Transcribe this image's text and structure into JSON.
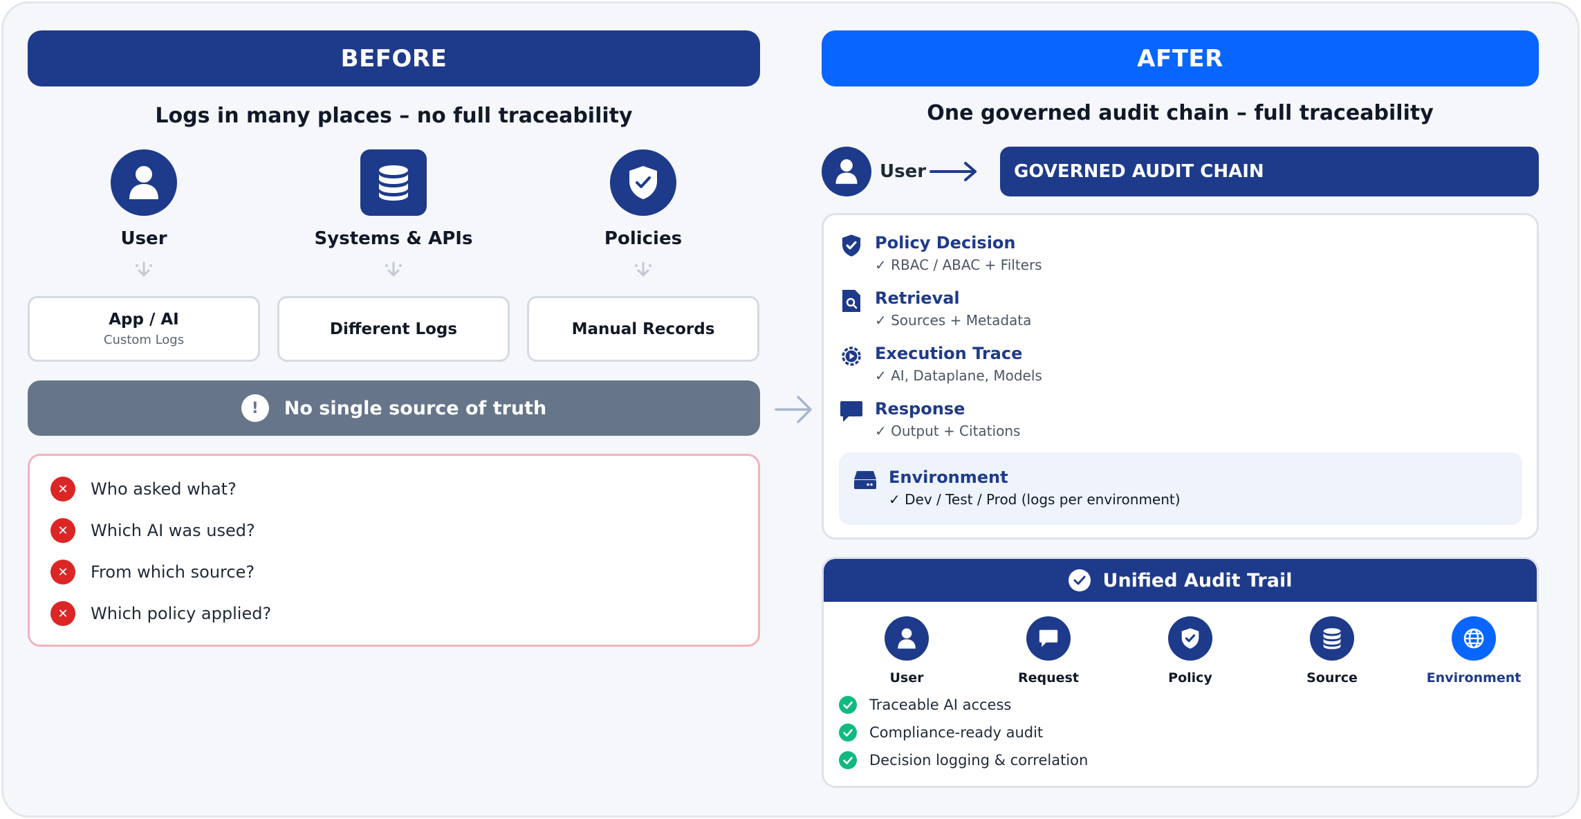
{
  "colors": {
    "navy": "#1e3a8a",
    "bright_blue": "#0866ff",
    "slate": "#667589",
    "error_red": "#dc2626",
    "success_green": "#10b981",
    "error_border": "#f1b3bb",
    "env_panel": "#eef3fc"
  },
  "before": {
    "header": "BEFORE",
    "subtitle": "Logs in many places – no full traceability",
    "columns": [
      {
        "icon": "user-icon",
        "label": "User",
        "box_title": "App / AI",
        "box_sub": "Custom Logs"
      },
      {
        "icon": "database-icon",
        "label": "Systems & APIs",
        "box_title": "Different Logs",
        "box_sub": ""
      },
      {
        "icon": "shield-check-icon",
        "label": "Policies",
        "box_title": "Manual Records",
        "box_sub": ""
      }
    ],
    "no_truth": {
      "icon": "exclamation-icon",
      "glyph": "!",
      "label": "No single source of truth"
    },
    "questions": [
      "Who asked what?",
      "Which AI was used?",
      "From which source?",
      "Which policy applied?"
    ]
  },
  "after": {
    "header": "AFTER",
    "subtitle": "One governed audit chain – full traceability",
    "user_label": "User",
    "chain_label": "GOVERNED AUDIT CHAIN",
    "steps": [
      {
        "icon": "shield-check-icon",
        "title": "Policy Decision",
        "detail": "✓ RBAC / ABAC + Filters"
      },
      {
        "icon": "document-search-icon",
        "title": "Retrieval",
        "detail": "✓ Sources + Metadata"
      },
      {
        "icon": "gear-play-icon",
        "title": "Execution Trace",
        "detail": "✓ AI, Dataplane, Models"
      },
      {
        "icon": "chat-bubble-icon",
        "title": "Response",
        "detail": "✓ Output + Citations"
      }
    ],
    "environment": {
      "icon": "server-icon",
      "title": "Environment",
      "detail": "✓ Dev / Test / Prod (logs per environment)"
    },
    "trail": {
      "title": "Unified Audit Trail",
      "items": [
        {
          "icon": "user-icon",
          "label": "User",
          "highlight": false
        },
        {
          "icon": "chat-bubble-icon",
          "label": "Request",
          "highlight": false
        },
        {
          "icon": "shield-check-icon",
          "label": "Policy",
          "highlight": false
        },
        {
          "icon": "database-icon",
          "label": "Source",
          "highlight": false
        },
        {
          "icon": "globe-icon",
          "label": "Environment",
          "highlight": true
        }
      ],
      "benefits": [
        "Traceable AI access",
        "Compliance-ready audit",
        "Decision logging & correlation"
      ]
    }
  }
}
